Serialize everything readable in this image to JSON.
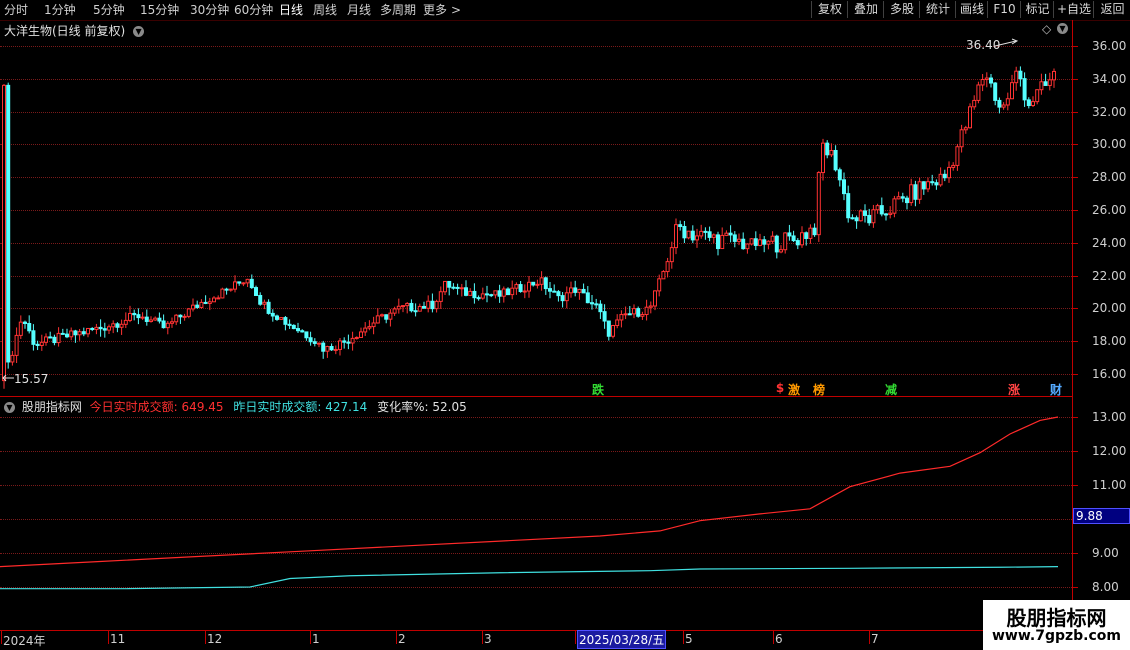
{
  "toolbar": {
    "tabs": [
      "分时",
      "1分钟",
      "5分钟",
      "15分钟",
      "30分钟",
      "60分钟",
      "日线",
      "周线",
      "月线",
      "多周期",
      "更多"
    ],
    "more_arrow": ">",
    "right_buttons": [
      "复权",
      "叠加",
      "多股",
      "统计",
      "画线",
      "F10",
      "标记",
      "+自选",
      "返回"
    ]
  },
  "main_panel": {
    "title": "大洋生物(日线 前复权)",
    "high_label": "36.40",
    "low_label": "15.57",
    "y_labels": [
      "36.00",
      "34.00",
      "32.00",
      "30.00",
      "28.00",
      "26.00",
      "24.00",
      "22.00",
      "20.00",
      "18.00",
      "16.00"
    ],
    "markers": [
      {
        "text": "跌",
        "color": "#33dd33"
      },
      {
        "text": "$",
        "color": "#ff3333"
      },
      {
        "text": "激",
        "color": "#ff9900"
      },
      {
        "text": "榜",
        "color": "#ff9900"
      },
      {
        "text": "减",
        "color": "#33dd33"
      },
      {
        "text": "涨",
        "color": "#ff4444"
      },
      {
        "text": "财",
        "color": "#55aaff"
      }
    ]
  },
  "indicator_panel": {
    "name": "股朋指标网",
    "today_label": "今日实时成交额:",
    "today_value": "649.45",
    "yesterday_label": "昨日实时成交额:",
    "yesterday_value": "427.14",
    "change_label": "变化率%:",
    "change_value": "52.05",
    "y_labels": [
      "13.00",
      "12.00",
      "11.00",
      "9.00",
      "8.00"
    ],
    "current_value_box": "9.88"
  },
  "x_axis": {
    "labels": [
      "2024年",
      "11",
      "12",
      "1",
      "2",
      "3",
      "2025/03/28/五",
      "5",
      "6",
      "7"
    ]
  },
  "colors": {
    "up": "#ff3333",
    "down": "#55ffff",
    "today_line": "#ff2a2a",
    "yesterday_line": "#40e0e0",
    "grid": "#7a1a1a"
  },
  "watermark": {
    "title": "股朋指标网",
    "url": "www.7gpzb.com"
  }
}
